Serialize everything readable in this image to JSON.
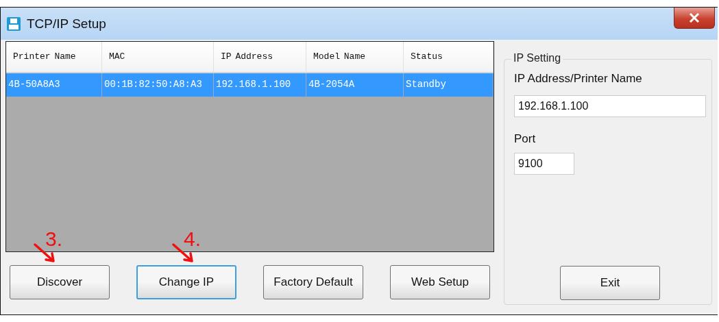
{
  "window": {
    "title": "TCP/IP Setup"
  },
  "table": {
    "columns": [
      "Printer Name",
      "MAC",
      "IP Address",
      "Model Name",
      "Status"
    ],
    "rows": [
      {
        "cells": [
          "4B-50A8A3",
          "00:1B:82:50:A8:A3",
          "192.168.1.100",
          "4B-2054A",
          "Standby"
        ],
        "selected": true
      }
    ]
  },
  "ip_setting": {
    "title": "IP Setting",
    "address_label": "IP Address/Printer Name",
    "address_value": "192.168.1.100",
    "port_label": "Port",
    "port_value": "9100",
    "exit_button": "Exit"
  },
  "buttons": [
    {
      "label": "Discover",
      "focused": false,
      "annotation": "3."
    },
    {
      "label": "Change IP",
      "focused": true,
      "annotation": "4."
    },
    {
      "label": "Factory Default",
      "focused": false
    },
    {
      "label": "Web Setup",
      "focused": false
    }
  ]
}
